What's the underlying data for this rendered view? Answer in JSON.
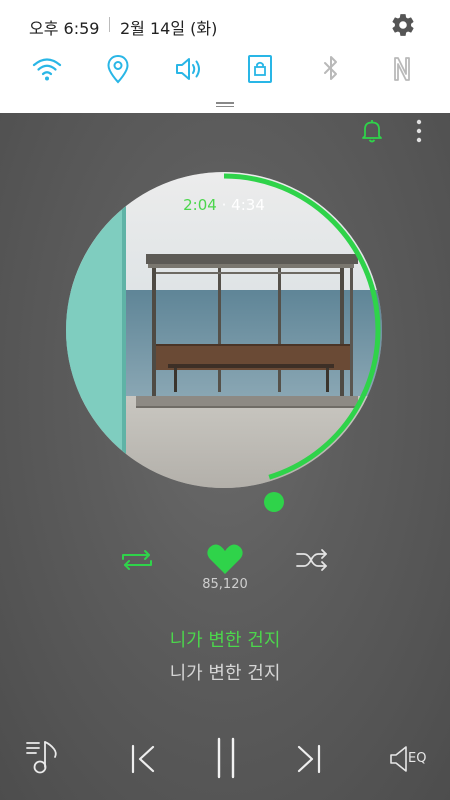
{
  "status": {
    "time": "오후 6:59",
    "date": "2월 14일 (화)"
  },
  "quick_settings": {
    "toggles": [
      {
        "name": "wifi-icon",
        "active": true
      },
      {
        "name": "location-icon",
        "active": true
      },
      {
        "name": "sound-icon",
        "active": true
      },
      {
        "name": "screen-rotation-lock-icon",
        "active": true
      },
      {
        "name": "bluetooth-icon",
        "active": false
      },
      {
        "name": "nfc-icon",
        "active": false
      }
    ],
    "accent_color": "#29b6e6"
  },
  "player": {
    "elapsed": "2:04",
    "separator": "·",
    "duration": "4:34",
    "progress": 0.4526,
    "like_count": "85,120",
    "liked": true,
    "lyric_current": "니가 변한 건지",
    "lyric_next": "니가 변한 건지",
    "accent_color": "#2fd34a",
    "eq_label": "EQ"
  }
}
